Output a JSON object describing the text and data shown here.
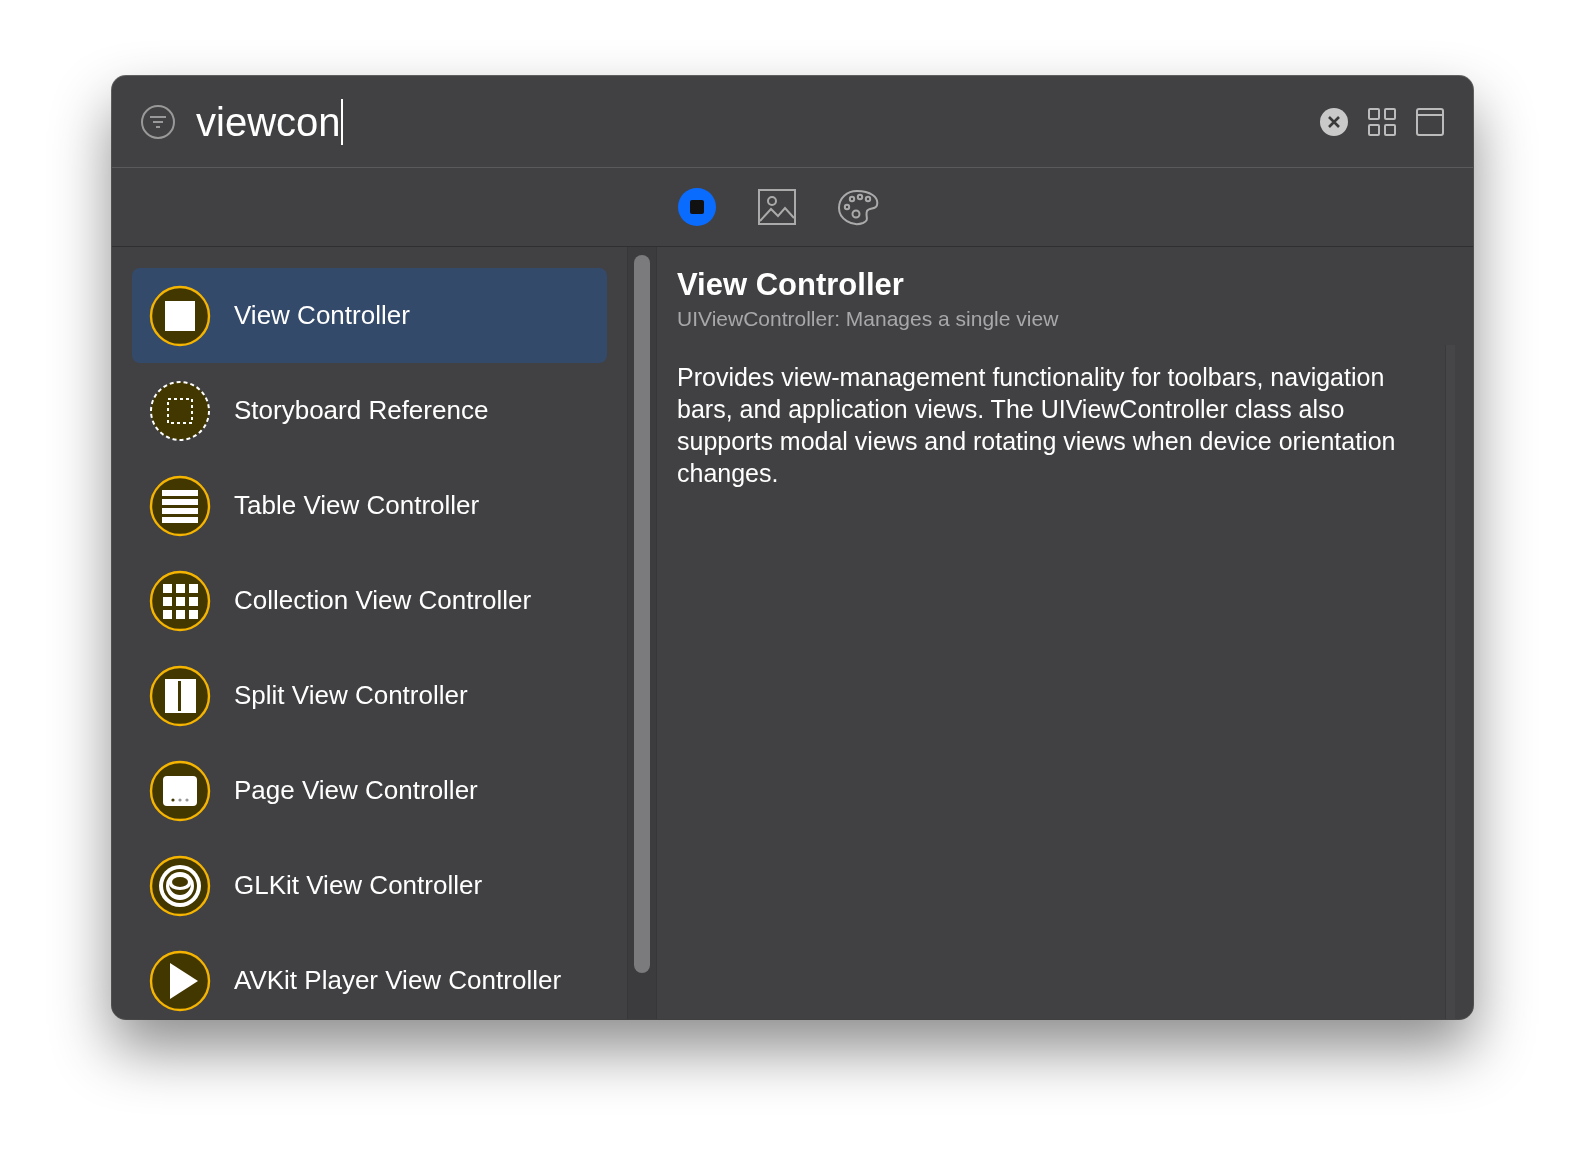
{
  "search": {
    "value": "viewcon"
  },
  "library_tabs": [
    {
      "kind": "objects",
      "selected": true
    },
    {
      "kind": "media",
      "selected": false
    },
    {
      "kind": "colors",
      "selected": false
    }
  ],
  "items": [
    {
      "kind": "square",
      "label": "View Controller",
      "selected": true
    },
    {
      "kind": "dashed",
      "label": "Storyboard Reference",
      "selected": false
    },
    {
      "kind": "table",
      "label": "Table View Controller",
      "selected": false
    },
    {
      "kind": "grid",
      "label": "Collection View Controller",
      "selected": false
    },
    {
      "kind": "split",
      "label": "Split View Controller",
      "selected": false
    },
    {
      "kind": "page",
      "label": "Page View Controller",
      "selected": false
    },
    {
      "kind": "glkit",
      "label": "GLKit View Controller",
      "selected": false
    },
    {
      "kind": "play",
      "label": "AVKit Player View Controller",
      "selected": false
    }
  ],
  "detail": {
    "title": "View Controller",
    "subtitle": "UIViewController: Manages a single view",
    "description": "Provides view-management functionality for toolbars, navigation bars, and application views. The UIViewController class also supports modal views and rotating views when device orientation changes."
  }
}
